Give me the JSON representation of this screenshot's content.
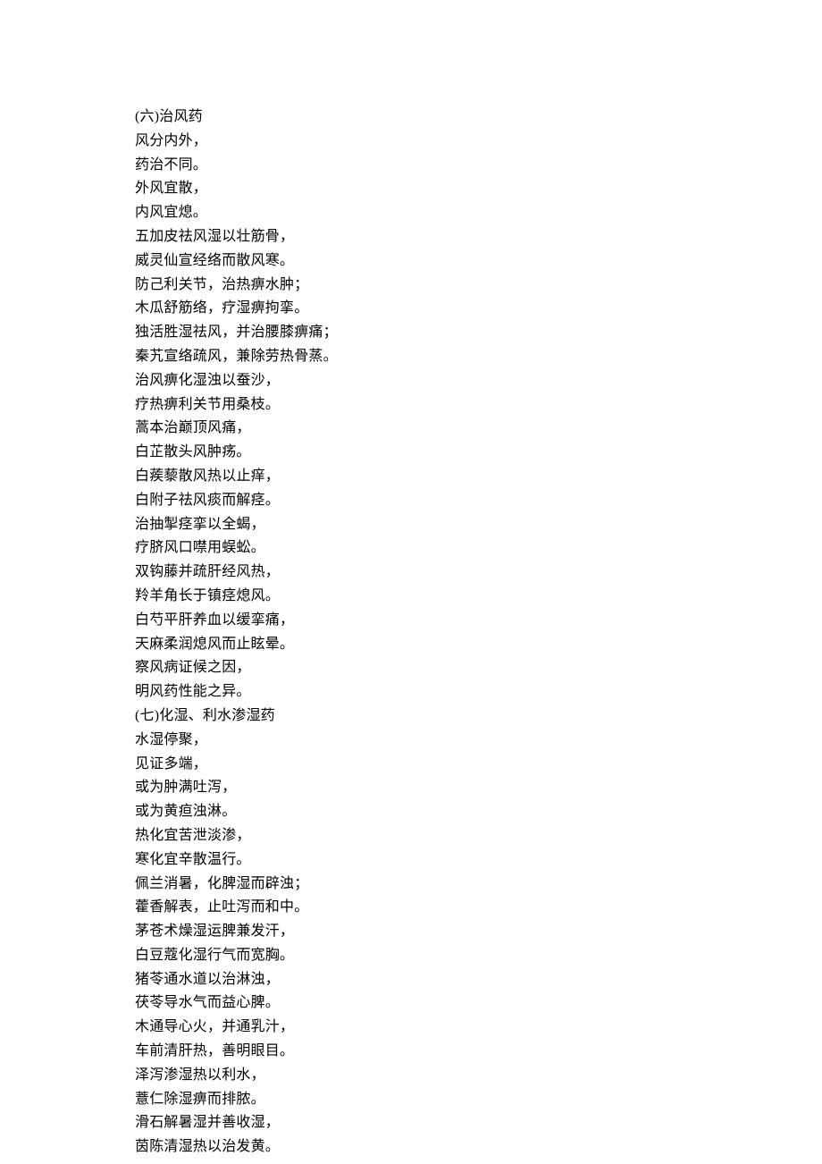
{
  "lines": [
    "(六)治风药",
    "风分内外，",
    "药治不同。",
    "外风宜散，",
    "内风宜熄。",
    "五加皮祛风湿以壮筋骨，",
    "威灵仙宣经络而散风寒。",
    "防己利关节，治热痹水肿；",
    "木瓜舒筋络，疗湿痹拘挛。",
    "独活胜湿祛风，并治腰膝痹痛；",
    "秦艽宣络疏风，兼除劳热骨蒸。",
    "治风痹化湿浊以蚕沙，",
    "疗热痹利关节用桑枝。",
    "蒿本治巅顶风痛，",
    "白芷散头风肿疡。",
    "白蒺藜散风热以止痒，",
    "白附子祛风痰而解痉。",
    "治抽掣痉挛以全蝎，",
    "疗脐风口噤用蜈蚣。",
    "双钩藤并疏肝经风热，",
    "羚羊角长于镇痉熄风。",
    "白芍平肝养血以缓挛痛，",
    "天麻柔润熄风而止眩晕。",
    "察风病证候之因，",
    "明风药性能之异。",
    "(七)化湿、利水渗湿药",
    "水湿停聚，",
    "见证多端，",
    "或为肿满吐泻，",
    "或为黄疸浊淋。",
    "热化宜苦泄淡渗，",
    "寒化宜辛散温行。",
    "佩兰消暑，化脾湿而辟浊；",
    "藿香解表，止吐泻而和中。",
    "茅苍术燥湿运脾兼发汗，",
    "白豆蔻化湿行气而宽胸。",
    "猪苓通水道以治淋浊，",
    "茯苓导水气而益心脾。",
    "木通导心火，并通乳汁，",
    "车前清肝热，善明眼目。",
    "泽泻渗湿热以利水，",
    "薏仁除湿痹而排脓。",
    "滑石解暑湿并善收湿，",
    "茵陈清湿热以治发黄。"
  ]
}
